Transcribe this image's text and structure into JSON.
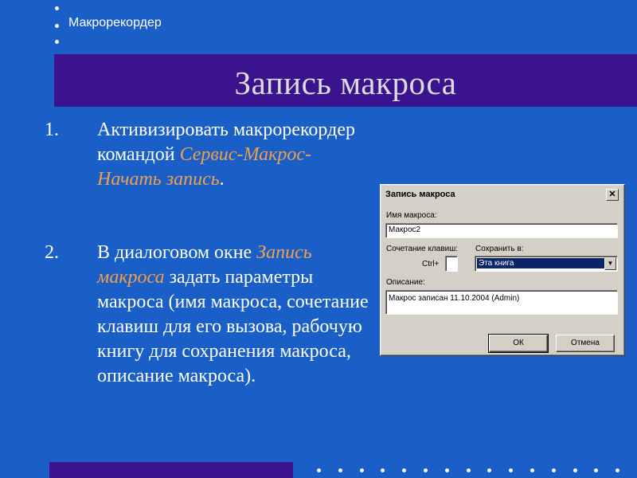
{
  "header": {
    "label": "Макрорекордер"
  },
  "slide": {
    "title": "Запись макроса",
    "items": [
      {
        "num": "1.",
        "text_a": "Активизировать макрорекордер командой ",
        "highlight": "Сервис-Макрос-Начать запись",
        "text_b": "."
      },
      {
        "num": "2.",
        "text_a": "В диалоговом окне ",
        "highlight": "Запись макроса",
        "text_b": " задать параметры макроса (имя макроса, сочетание клавиш для его вызова, рабочую книгу для сохранения макроса, описание макроса)."
      }
    ]
  },
  "dialog": {
    "title": "Запись макроса",
    "close_glyph": "✕",
    "macro_name_label": "Имя макроса:",
    "macro_name_value": "Макрос2",
    "shortcut_label": "Сочетание клавиш:",
    "ctrl_label": "Ctrl+",
    "ctrl_value": "",
    "save_in_label": "Сохранить в:",
    "save_in_value": "Эта книга",
    "description_label": "Описание:",
    "description_value": "Макрос записан 11.10.2004 (Admin)",
    "ok_label": "ОК",
    "cancel_label": "Отмена"
  },
  "colors": {
    "background": "#1a5fc8",
    "title_bar": "#3b138f",
    "highlight": "#f0a04a"
  }
}
